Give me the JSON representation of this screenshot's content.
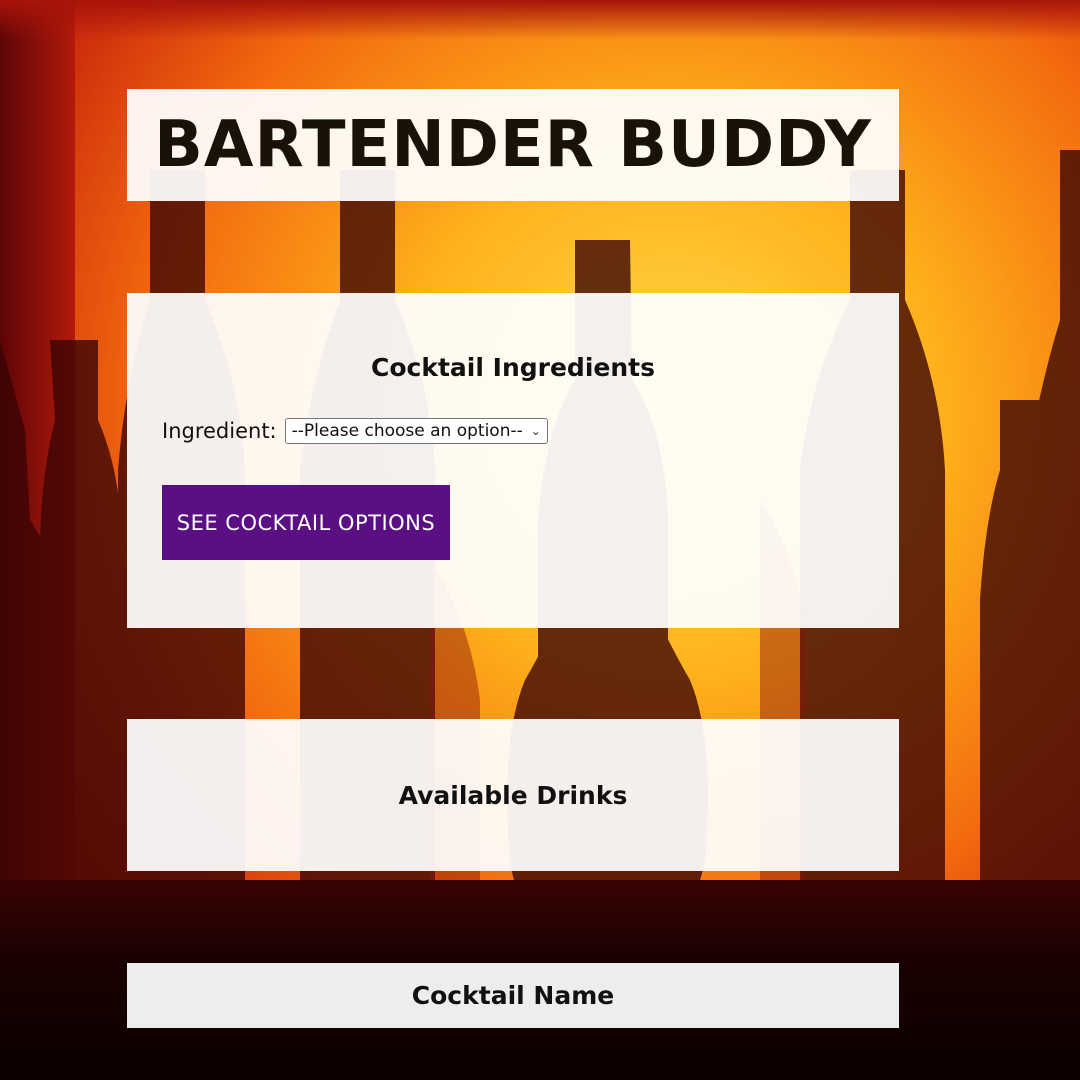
{
  "header": {
    "title": "BARTENDER BUDDY"
  },
  "ingredients_section": {
    "title": "Cocktail Ingredients",
    "ingredient_label": "Ingredient:",
    "select_value": "--Please choose an option--",
    "submit_label": "SEE COCKTAIL OPTIONS"
  },
  "drinks_section": {
    "title": "Available Drinks"
  },
  "cocktail_section": {
    "title": "Cocktail Name"
  },
  "colors": {
    "button_bg": "#5a0f82",
    "panel_bg": "#ffffff",
    "title_text": "#1a1208"
  },
  "icons": {
    "select_chevron": "chevron-down-icon"
  }
}
